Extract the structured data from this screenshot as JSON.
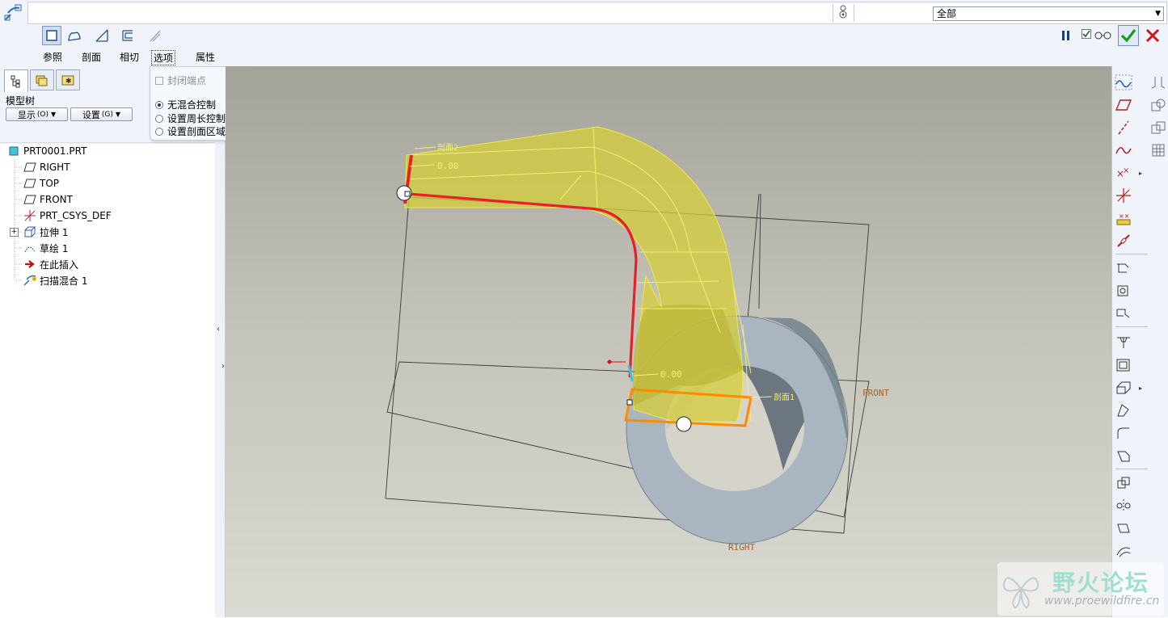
{
  "dashboard": {
    "tabs": [
      {
        "label": "参照"
      },
      {
        "label": "剖面"
      },
      {
        "label": "相切"
      },
      {
        "label": "选项"
      },
      {
        "label": "属性"
      }
    ],
    "filter_value": "全部"
  },
  "options_popup": {
    "close_ends_label": "封闭端点",
    "radio_no_blend": "无混合控制",
    "radio_perimeter": "设置周长控制",
    "radio_area": "设置剖面区域控制"
  },
  "left_panel": {
    "title": "模型树",
    "show_button": "显示",
    "show_shortcut": "(O)",
    "settings_button": "设置",
    "settings_shortcut": "(G)",
    "tree": [
      {
        "label": "PRT0001.PRT",
        "icon": "part-icon"
      },
      {
        "label": "RIGHT",
        "icon": "datum-plane-icon"
      },
      {
        "label": "TOP",
        "icon": "datum-plane-icon"
      },
      {
        "label": "FRONT",
        "icon": "datum-plane-icon"
      },
      {
        "label": "PRT_CSYS_DEF",
        "icon": "csys-icon"
      },
      {
        "label": "拉伸 1",
        "icon": "extrude-icon"
      },
      {
        "label": "草绘 1",
        "icon": "sketch-icon"
      },
      {
        "label": "在此插入",
        "icon": "insert-arrow-icon"
      },
      {
        "label": "扫描混合 1",
        "icon": "swept-blend-icon"
      }
    ]
  },
  "viewport": {
    "dim1": "0.00",
    "dim2": "0.00",
    "label_top": "剖面2",
    "label_bottom": "剖面1",
    "plane_front": "FRONT",
    "plane_right": "RIGHT"
  },
  "watermark": {
    "title": "野火论坛",
    "url": "www.proewildfire.cn"
  },
  "colors": {
    "accent_yellow": "#e8e25a",
    "trajectory_red": "#e8202a",
    "section_orange": "#ff8a00",
    "ring_gray": "#a7b4bf"
  }
}
